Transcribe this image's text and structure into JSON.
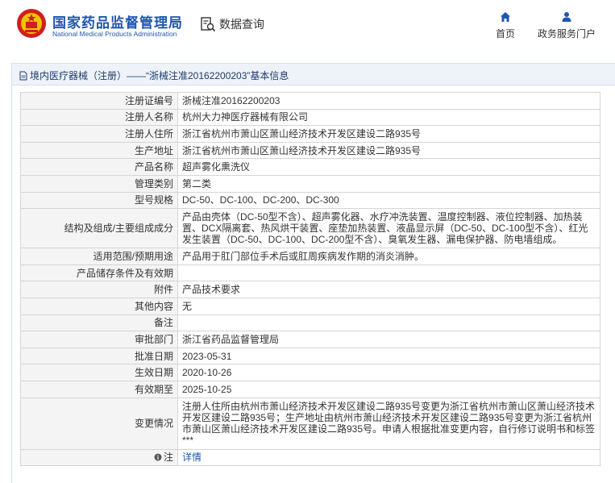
{
  "header": {
    "brand_cn": "国家药品监督管理局",
    "brand_en": "National Medical Products Administration",
    "query_label": "数据查询",
    "nav": [
      {
        "label": "首页",
        "icon": "home-icon"
      },
      {
        "label": "政务服务门户",
        "icon": "user-icon"
      }
    ]
  },
  "breadcrumb": "境内医疗器械（注册）——“浙械注准20162200203”基本信息",
  "fields": [
    {
      "label": "注册证编号",
      "value": "浙械注准20162200203"
    },
    {
      "label": "注册人名称",
      "value": "杭州大力神医疗器械有限公司"
    },
    {
      "label": "注册人住所",
      "value": "浙江省杭州市萧山区萧山经济技术开发区建设二路935号"
    },
    {
      "label": "生产地址",
      "value": "浙江省杭州市萧山区萧山经济技术开发区建设二路935号"
    },
    {
      "label": "产品名称",
      "value": "超声雾化熏洗仪"
    },
    {
      "label": "管理类别",
      "value": "第二类"
    },
    {
      "label": "型号规格",
      "value": "DC-50、DC-100、DC-200、DC-300"
    },
    {
      "label": "结构及组成/主要组成成分",
      "value": "产品由壳体（DC-50型不含）、超声雾化器、水疗冲洗装置、温度控制器、液位控制器、加热装置、DCX隔离套、热风烘干装置、座垫加热装置、液晶显示屏（DC-50、DC-100型不含）、红光发生装置（DC-50、DC-100、DC-200型不含）、臭氧发生器、漏电保护器、防电墙组成。"
    },
    {
      "label": "适用范围/预期用途",
      "value": "产品用于肛门部位手术后或肛周疾病发作期的消炎消肿。"
    },
    {
      "label": "产品储存条件及有效期",
      "value": ""
    },
    {
      "label": "附件",
      "value": "产品技术要求"
    },
    {
      "label": "其他内容",
      "value": "无"
    },
    {
      "label": "备注",
      "value": ""
    },
    {
      "label": "审批部门",
      "value": "浙江省药品监督管理局"
    },
    {
      "label": "批准日期",
      "value": "2023-05-31"
    },
    {
      "label": "生效日期",
      "value": "2020-10-26"
    },
    {
      "label": "有效期至",
      "value": "2025-10-25"
    },
    {
      "label": "变更情况",
      "value": "注册人住所由杭州市萧山经济技术开发区建设二路935号变更为浙江省杭州市萧山区萧山经济技术开发区建设二路935号；生产地址由杭州市萧山经济技术开发区建设二路935号变更为浙江省杭州市萧山区萧山经济技术开发区建设二路935号。申请人根据批准变更内容，自行修订说明书和标签***"
    },
    {
      "label": "注",
      "value": "详情",
      "icon": "info-icon"
    }
  ],
  "colors": {
    "brand": "#1f56b0",
    "label_bg": "#f4f4f4",
    "bar_bg": "#eef3f9"
  }
}
